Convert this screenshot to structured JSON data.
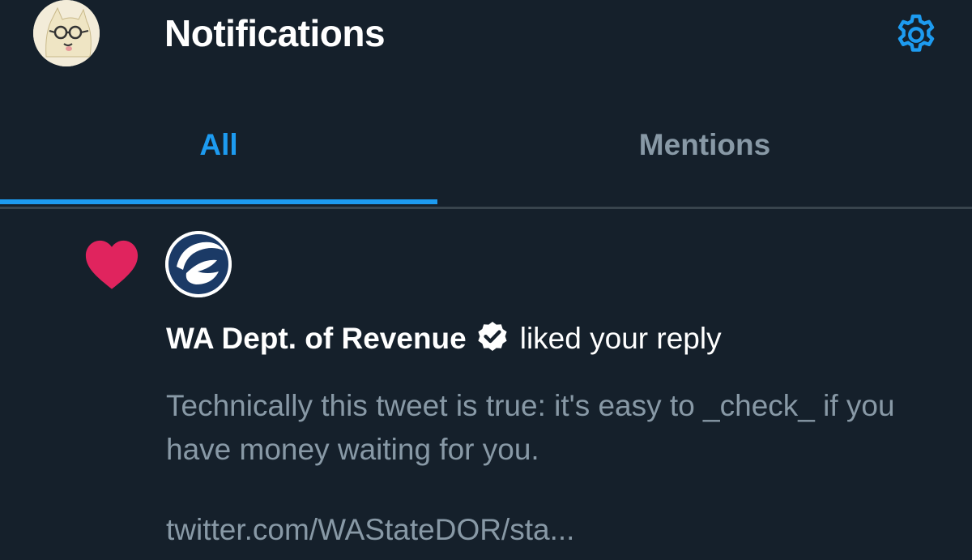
{
  "header": {
    "title": "Notifications",
    "settings_icon": "gear-icon",
    "avatar_icon": "cartoon-cat-avatar"
  },
  "tabs": [
    {
      "label": "All",
      "active": true
    },
    {
      "label": "Mentions",
      "active": false
    }
  ],
  "notification": {
    "type_icon": "heart-icon",
    "org_name": "WA Dept. of Revenue",
    "verified": true,
    "action": "liked your reply",
    "tweet_text": "Technically this tweet is true: it's easy to _check_ if you have money waiting for you.",
    "link": "twitter.com/WAStateDOR/sta..."
  },
  "colors": {
    "background": "#15202b",
    "accent": "#1d9bf0",
    "muted": "#8899a6",
    "like": "#e0245e"
  }
}
